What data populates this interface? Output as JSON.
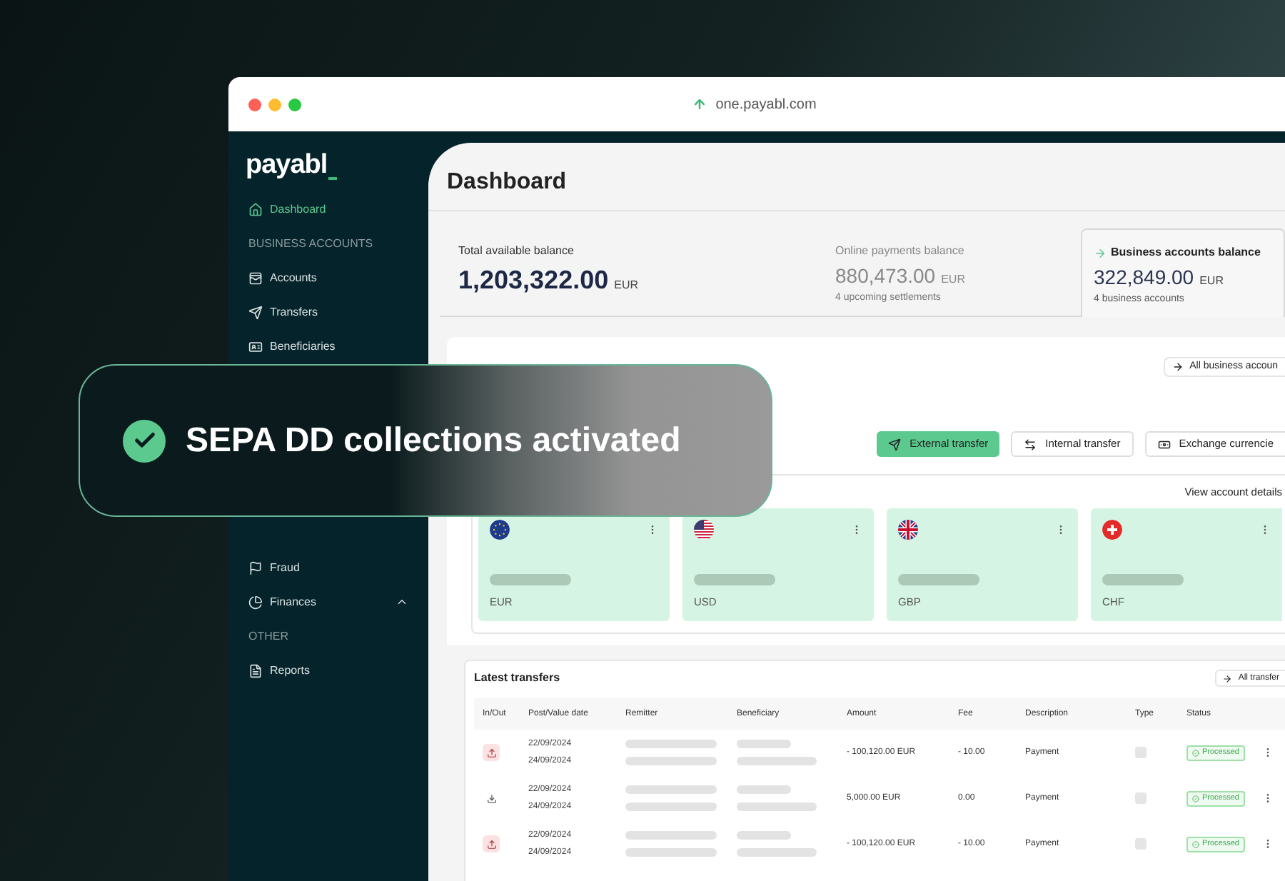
{
  "browser": {
    "url": "one.payabl.com"
  },
  "sidebar": {
    "logo": "payabl",
    "items": [
      {
        "kind": "link",
        "label": "Dashboard",
        "selected": true
      },
      {
        "kind": "section",
        "label": "BUSINESS ACCOUNTS"
      },
      {
        "kind": "link",
        "label": "Accounts",
        "selected": false
      },
      {
        "kind": "link",
        "label": "Transfers",
        "selected": false
      },
      {
        "kind": "link",
        "label": "Beneficiaries",
        "selected": false
      },
      {
        "kind": "gap"
      },
      {
        "kind": "link",
        "label": "Fraud",
        "selected": false
      },
      {
        "kind": "link",
        "label": "Finances",
        "selected": false,
        "expanded": true
      },
      {
        "kind": "section",
        "label": "OTHER"
      },
      {
        "kind": "link",
        "label": "Reports",
        "selected": false
      }
    ]
  },
  "toast": {
    "text": "SEPA DD collections activated"
  },
  "main": {
    "title": "Dashboard",
    "balances": [
      {
        "label": "Total available balance",
        "amount": "1,203,322.00",
        "currency": "EUR",
        "selected": false,
        "primary": true
      },
      {
        "label": "Online payments balance",
        "amount": "880,473.00",
        "currency": "EUR",
        "note": "4 upcoming settlements",
        "selected": false
      },
      {
        "label": "Business accounts balance",
        "amount": "322,849.00",
        "currency": "EUR",
        "note": "4 business accounts",
        "selected": true
      }
    ],
    "business_accounts": {
      "link": "All business accoun",
      "actions": [
        {
          "label": "External transfer",
          "primary": true
        },
        {
          "label": "Internal transfer",
          "primary": false
        },
        {
          "label": "Exchange currencie",
          "primary": false
        }
      ],
      "details_link": "View account details",
      "accounts": [
        {
          "code": "EUR"
        },
        {
          "code": "USD"
        },
        {
          "code": "GBP"
        },
        {
          "code": "CHF"
        }
      ]
    },
    "transfers": {
      "title": "Latest transfers",
      "link": "All transfer",
      "columns": [
        "In/Out",
        "Post/Value date",
        "Remitter",
        "Beneficiary",
        "Amount",
        "Fee",
        "Description",
        "Type",
        "Status"
      ],
      "rows": [
        {
          "outgoing": true,
          "post_date": "22/09/2024",
          "value_date": "24/09/2024",
          "amount": "- 100,120.00 EUR",
          "fee": "- 10.00",
          "description": "Payment",
          "status": "Processed"
        },
        {
          "outgoing": false,
          "post_date": "22/09/2024",
          "value_date": "24/09/2024",
          "amount": "5,000.00 EUR",
          "fee": "0.00",
          "description": "Payment",
          "status": "Processed"
        },
        {
          "outgoing": true,
          "post_date": "22/09/2024",
          "value_date": "24/09/2024",
          "amount": "- 100,120.00 EUR",
          "fee": "- 10.00",
          "description": "Payment",
          "status": "Processed"
        }
      ]
    }
  }
}
